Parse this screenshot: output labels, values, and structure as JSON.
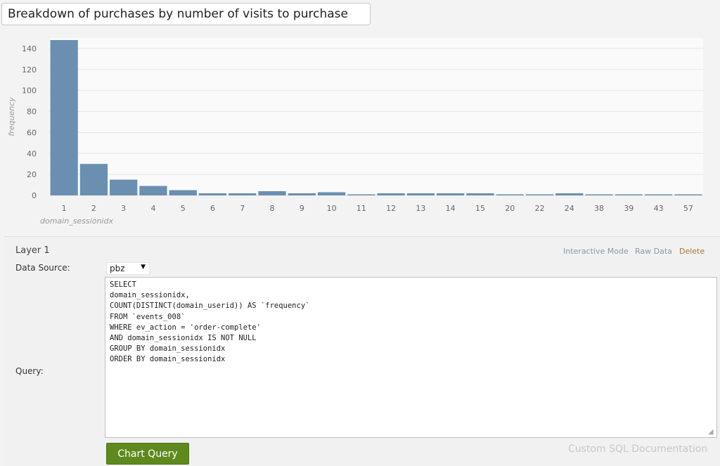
{
  "header": {
    "title": "Breakdown of purchases by number of visits to purchase"
  },
  "chart_data": {
    "type": "bar",
    "title": "",
    "xlabel": "domain_sessionidx",
    "ylabel": "frequency",
    "ylim": [
      0,
      150
    ],
    "yticks": [
      0,
      20,
      40,
      60,
      80,
      100,
      120,
      140
    ],
    "grid": true,
    "bar_color": "#6a8fb1",
    "categories": [
      "1",
      "2",
      "3",
      "4",
      "5",
      "6",
      "7",
      "8",
      "9",
      "10",
      "11",
      "12",
      "13",
      "14",
      "15",
      "20",
      "22",
      "24",
      "38",
      "39",
      "43",
      "57"
    ],
    "values": [
      148,
      30,
      15,
      9,
      5,
      2,
      2,
      4,
      2,
      3,
      1,
      2,
      2,
      2,
      2,
      1,
      1,
      2,
      1,
      1,
      1,
      1
    ]
  },
  "layer": {
    "title": "Layer 1",
    "links": {
      "interactive_mode": "Interactive Mode",
      "raw_data": "Raw Data",
      "delete": "Delete"
    },
    "data_source_label": "Data Source:",
    "data_source_value": "pbz",
    "query_label": "Query:",
    "query_text": "SELECT\ndomain_sessionidx,\nCOUNT(DISTINCT(domain_userid)) AS `frequency`\nFROM `events_008`\nWHERE ev_action = 'order-complete'\nAND domain_sessionidx IS NOT NULL\nGROUP BY domain_sessionidx\nORDER BY domain_sessionidx",
    "chart_query_label": "Chart Query",
    "sql_doc_label": "Custom SQL Documentation"
  }
}
